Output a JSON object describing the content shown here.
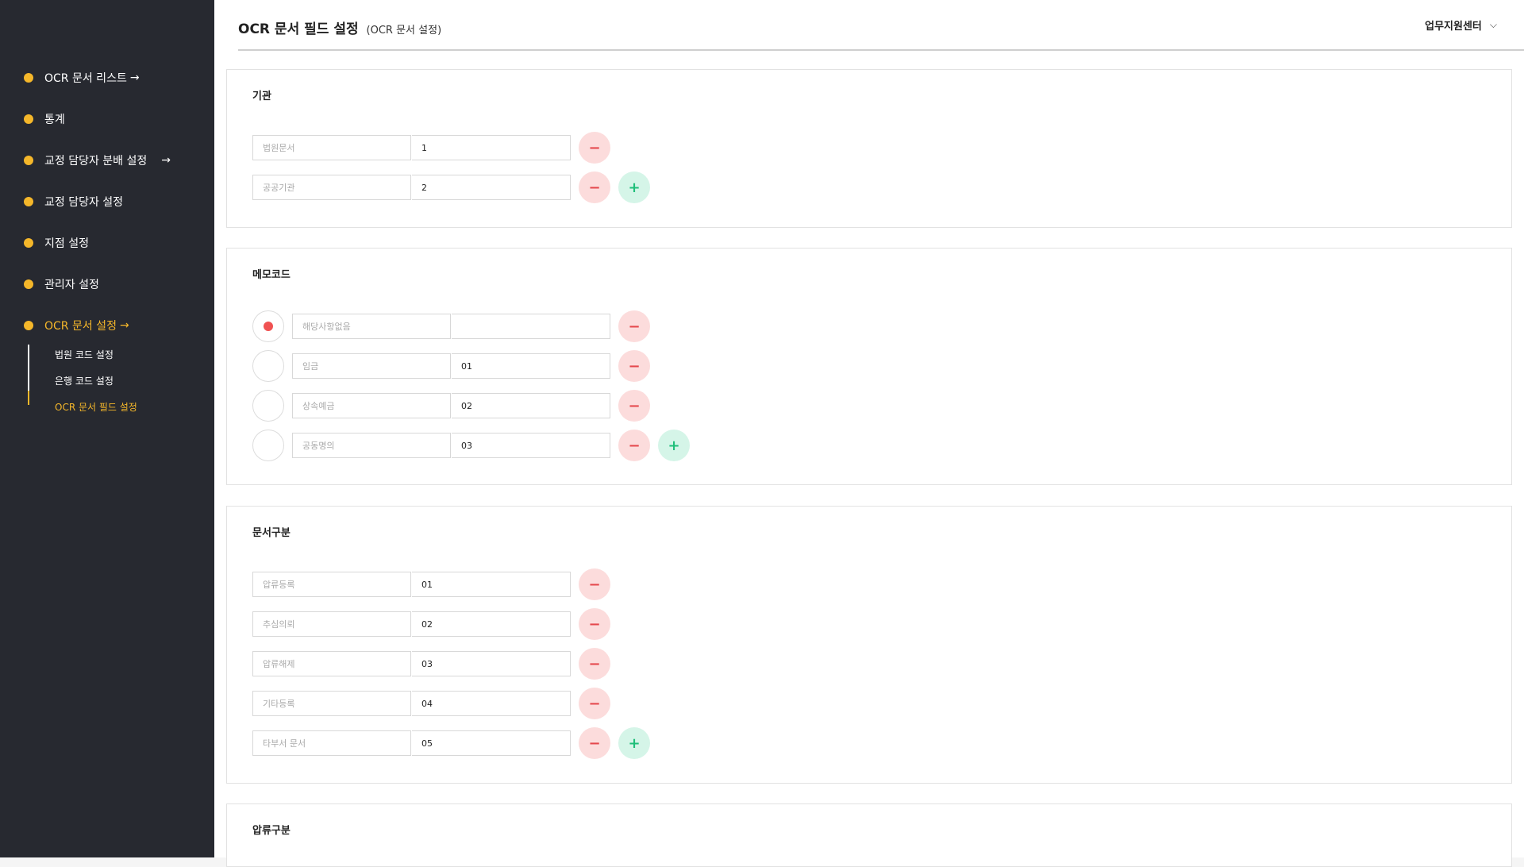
{
  "sidebar": {
    "items": [
      {
        "label": "OCR 문서 리스트",
        "arrow": "→"
      },
      {
        "label": "통계"
      },
      {
        "label": "교정 담당자 분배 설정",
        "arrow": "→"
      },
      {
        "label": "교정 담당자 설정"
      },
      {
        "label": "지점 설정"
      },
      {
        "label": "관리자 설정"
      },
      {
        "label": "OCR 문서 설정",
        "arrow": "→"
      }
    ],
    "subitems": [
      {
        "label": "법원 코드 설정"
      },
      {
        "label": "은행 코드 설정"
      },
      {
        "label": "OCR 문서 필드 설정"
      }
    ]
  },
  "header": {
    "title": "OCR 문서 필드 설정",
    "subtitle": "(OCR 문서 설정)",
    "user": "업무지원센터",
    "user_chevron": "⌵"
  },
  "icons": {
    "minus": "−",
    "plus": "+",
    "minus_name": "minus-icon",
    "plus_name": "plus-icon"
  },
  "sections": {
    "agency": {
      "title": "기관",
      "rows": [
        {
          "label": "법원문서",
          "value": "1"
        },
        {
          "label": "공공기관",
          "value": "2"
        }
      ]
    },
    "memo": {
      "title": "메모코드",
      "rows": [
        {
          "label": "해당사항없음",
          "value": "",
          "selected": true
        },
        {
          "label": "임금",
          "value": "01",
          "selected": false
        },
        {
          "label": "상속예금",
          "value": "02",
          "selected": false
        },
        {
          "label": "공동명의",
          "value": "03",
          "selected": false
        }
      ]
    },
    "doctype": {
      "title": "문서구분",
      "rows": [
        {
          "label": "압류등록",
          "value": "01"
        },
        {
          "label": "추심의뢰",
          "value": "02"
        },
        {
          "label": "압류해제",
          "value": "03"
        },
        {
          "label": "기타등록",
          "value": "04"
        },
        {
          "label": "타부서 문서",
          "value": "05"
        }
      ]
    },
    "seizure": {
      "title": "압류구분"
    }
  },
  "colors": {
    "accent": "#f5b72a",
    "sidebar_bg": "#272930",
    "minus_bg": "#fcdcdc",
    "minus_fg": "#e5484d",
    "plus_bg": "#d5f5e8",
    "plus_fg": "#1fbf7a"
  }
}
